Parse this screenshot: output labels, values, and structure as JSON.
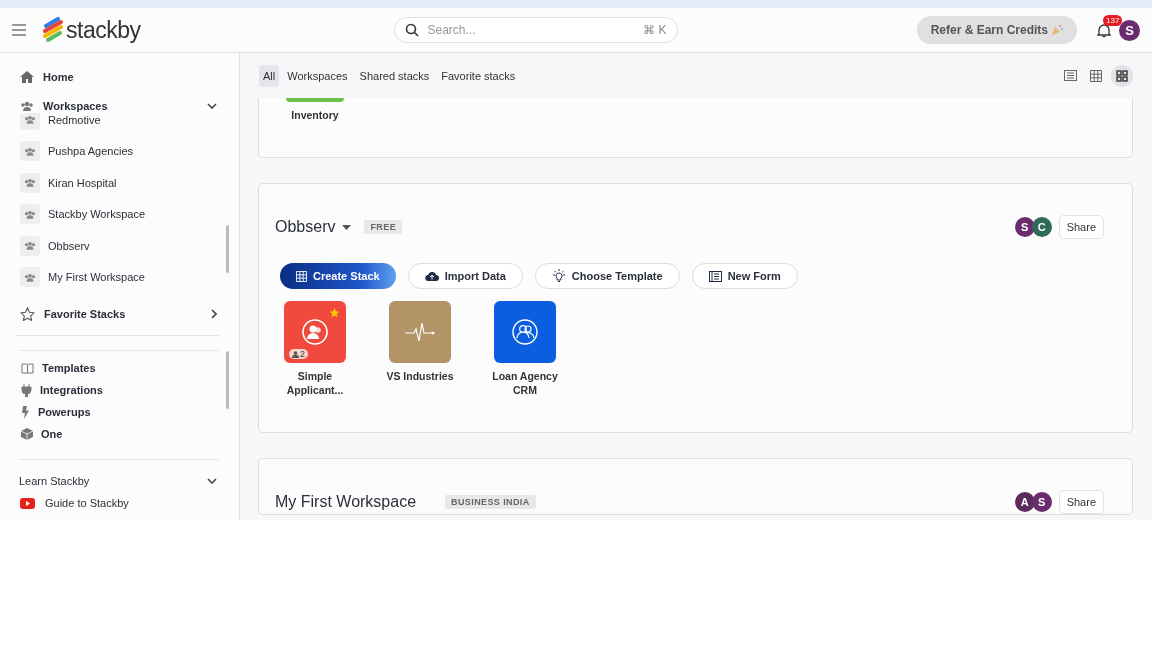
{
  "header": {
    "logo": "stackby",
    "search": {
      "placeholder": "Search...",
      "shortcut": "⌘ K"
    },
    "refer_button": "Refer & Earn Credits",
    "notifications": "137",
    "avatar": "S"
  },
  "tabs": [
    {
      "label": "All",
      "selected": true
    },
    {
      "label": "Workspaces",
      "selected": false
    },
    {
      "label": "Shared stacks",
      "selected": false
    },
    {
      "label": "Favorite stacks",
      "selected": false
    }
  ],
  "views": [
    {
      "kind": "list",
      "selected": false
    },
    {
      "kind": "grid",
      "selected": false
    },
    {
      "kind": "tiles",
      "selected": true
    }
  ],
  "sidebar": {
    "home": "Home",
    "workspaces": {
      "label": "Workspaces",
      "expanded": true,
      "items": [
        "Redmotive",
        "Pushpa Agencies",
        "Kiran Hospital",
        "Stackby Workspace",
        "Obbserv",
        "My First Workspace"
      ]
    },
    "favorites": {
      "label": "Favorite Stacks",
      "expanded": false
    },
    "links": [
      {
        "kind": "book",
        "label": "Templates"
      },
      {
        "kind": "plug",
        "label": "Integrations"
      },
      {
        "kind": "bolt",
        "label": "Powerups"
      },
      {
        "kind": "cube",
        "label": "One"
      }
    ],
    "learn": {
      "label": "Learn Stackby",
      "expanded": true,
      "items": [
        {
          "kind": "video",
          "label": "Guide to Stackby"
        }
      ]
    }
  },
  "workspaces": [
    {
      "partial": true,
      "stacks": [
        {
          "name": "Inventory",
          "color": "#6cc04a"
        }
      ]
    },
    {
      "partial": false,
      "name": "Obbserv",
      "dropdown": true,
      "plan": "FREE",
      "members": [
        {
          "initial": "S",
          "color": "#6b2c6e"
        },
        {
          "initial": "C",
          "color": "#2f6b5a"
        }
      ],
      "share": "Share",
      "actions": [
        {
          "kind": "create",
          "label": "Create Stack",
          "primary": true
        },
        {
          "kind": "import",
          "label": "Import Data",
          "primary": false
        },
        {
          "kind": "template",
          "label": "Choose Template",
          "primary": false
        },
        {
          "kind": "form",
          "label": "New Form",
          "primary": false
        }
      ],
      "stacks": [
        {
          "name": "Simple Applicant...",
          "color": "#f04a3e",
          "kind": "people",
          "favorite": true,
          "shared": "2"
        },
        {
          "name": "VS Industries",
          "color": "#b39467",
          "kind": "pulse",
          "favorite": false
        },
        {
          "name": "Loan Agency CRM",
          "color": "#0b5ee0",
          "kind": "people-ring",
          "favorite": false
        }
      ]
    },
    {
      "partial": false,
      "name": "My First Workspace",
      "dropdown": false,
      "plan": "BUSINESS INDIA",
      "members": [
        {
          "initial": "A",
          "color": "#5c2b5e"
        },
        {
          "initial": "S",
          "color": "#6b2c6e"
        }
      ],
      "share": "Share"
    }
  ]
}
